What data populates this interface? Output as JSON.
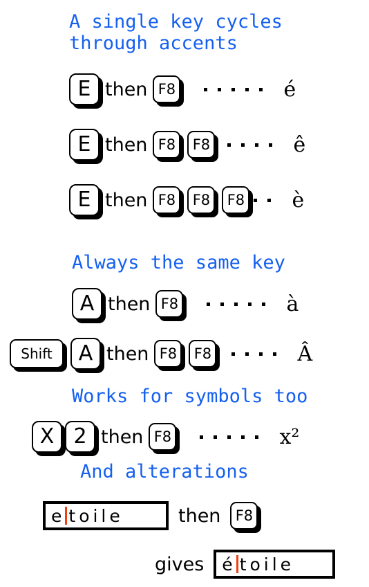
{
  "meta": {
    "accent_blue": "#1560f0",
    "caret_color": "#f04010",
    "key_color": "#000000",
    "background": "#ffffff"
  },
  "sections": [
    {
      "id": "accents",
      "heading": "A single key cycles\nthrough accents"
    },
    {
      "id": "same_key",
      "heading": "Always the same key"
    },
    {
      "id": "symbols",
      "heading": "Works for symbols too"
    },
    {
      "id": "alterations",
      "heading": "And alterations"
    }
  ],
  "connectors": {
    "then": "then",
    "gives": "gives"
  },
  "rows": [
    {
      "id": "e-f8-1",
      "keys_before": [
        "E"
      ],
      "then": "then",
      "keys_after": [
        "F8"
      ],
      "dots": 5,
      "result": "é"
    },
    {
      "id": "e-f8-2",
      "keys_before": [
        "E"
      ],
      "then": "then",
      "keys_after": [
        "F8",
        "F8"
      ],
      "dots": 4,
      "result": "ê"
    },
    {
      "id": "e-f8-3",
      "keys_before": [
        "E"
      ],
      "then": "then",
      "keys_after": [
        "F8",
        "F8",
        "F8"
      ],
      "dots": 2,
      "result": "è"
    },
    {
      "id": "a-f8-1",
      "keys_before": [
        "A"
      ],
      "then": "then",
      "keys_after": [
        "F8"
      ],
      "dots": 5,
      "result": "à"
    },
    {
      "id": "shift-a-f8-2",
      "keys_before": [
        "Shift",
        "A"
      ],
      "then": "then",
      "keys_after": [
        "F8",
        "F8"
      ],
      "dots": 4,
      "result": "Â"
    },
    {
      "id": "x-2-f8",
      "keys_before": [
        "X",
        "2"
      ],
      "then": "then",
      "keys_after": [
        "F8"
      ],
      "dots": 5,
      "result": "x²"
    }
  ],
  "alteration": {
    "input_field": {
      "before_caret": "e",
      "after_caret": "toile",
      "full_value": "etoile"
    },
    "then": "then",
    "key": "F8",
    "gives": "gives",
    "output_field": {
      "before_caret": "é",
      "after_caret": "toile",
      "full_value": "étoile"
    }
  }
}
